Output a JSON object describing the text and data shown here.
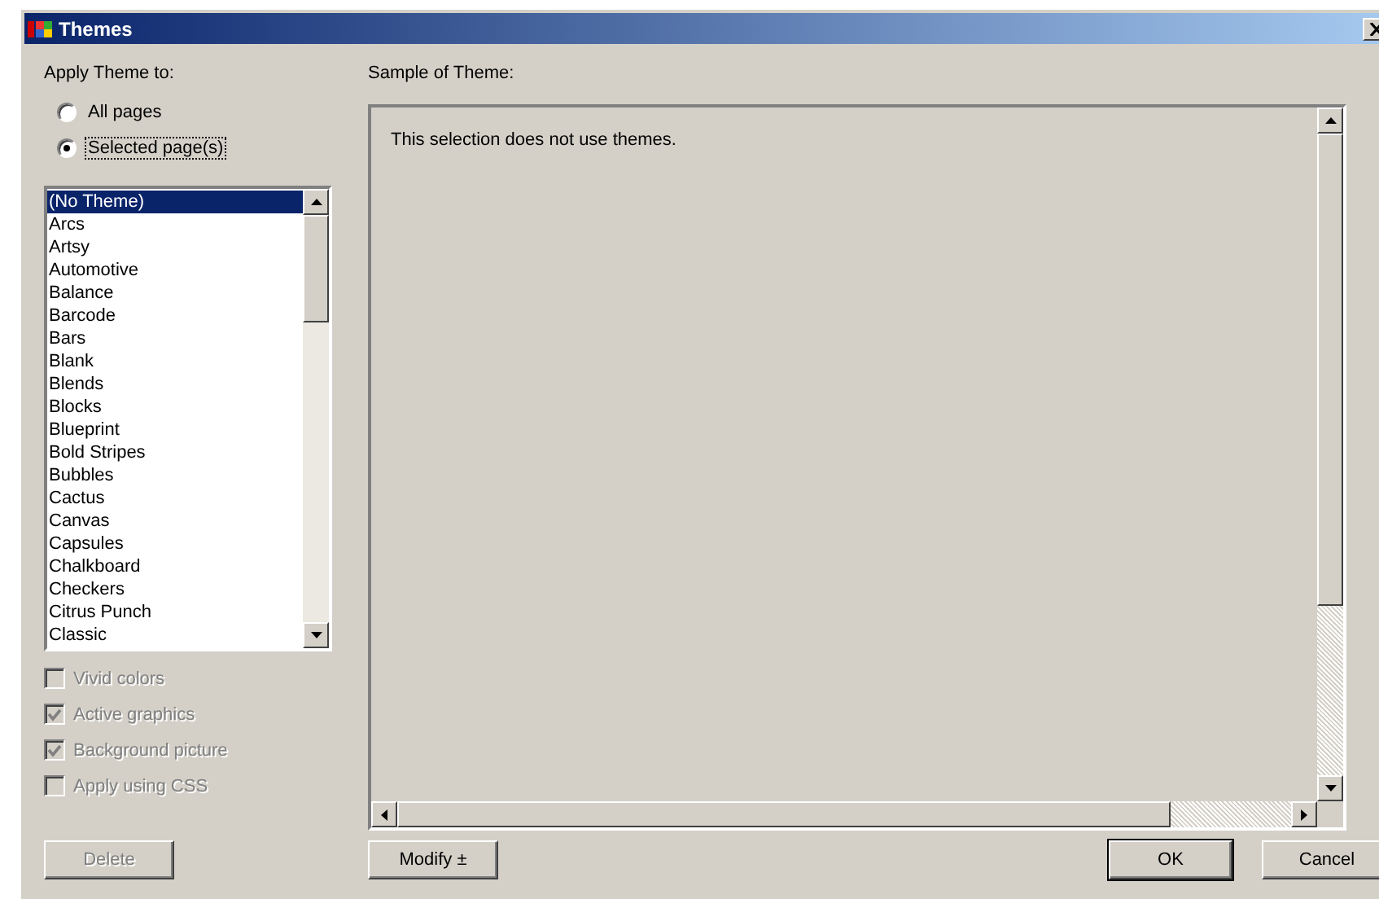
{
  "window": {
    "title": "Themes"
  },
  "apply": {
    "label": "Apply Theme to:",
    "options": [
      {
        "label": "All pages",
        "selected": false
      },
      {
        "label": "Selected page(s)",
        "selected": true
      }
    ]
  },
  "themes": [
    {
      "label": "(No Theme)",
      "selected": true
    },
    {
      "label": "Arcs",
      "selected": false
    },
    {
      "label": "Artsy",
      "selected": false
    },
    {
      "label": "Automotive",
      "selected": false
    },
    {
      "label": "Balance",
      "selected": false
    },
    {
      "label": "Barcode",
      "selected": false
    },
    {
      "label": "Bars",
      "selected": false
    },
    {
      "label": "Blank",
      "selected": false
    },
    {
      "label": "Blends",
      "selected": false
    },
    {
      "label": "Blocks",
      "selected": false
    },
    {
      "label": "Blueprint",
      "selected": false
    },
    {
      "label": "Bold Stripes",
      "selected": false
    },
    {
      "label": "Bubbles",
      "selected": false
    },
    {
      "label": "Cactus",
      "selected": false
    },
    {
      "label": "Canvas",
      "selected": false
    },
    {
      "label": "Capsules",
      "selected": false
    },
    {
      "label": "Chalkboard",
      "selected": false
    },
    {
      "label": "Checkers",
      "selected": false
    },
    {
      "label": "Citrus Punch",
      "selected": false
    },
    {
      "label": "Classic",
      "selected": false
    }
  ],
  "options": [
    {
      "label": "Vivid colors",
      "checked": false,
      "disabled": true
    },
    {
      "label": "Active graphics",
      "checked": true,
      "disabled": true
    },
    {
      "label": "Background picture",
      "checked": true,
      "disabled": true
    },
    {
      "label": "Apply using CSS",
      "checked": false,
      "disabled": true
    }
  ],
  "sample": {
    "label": "Sample of Theme:",
    "message": "This selection does not use themes."
  },
  "buttons": {
    "delete": {
      "label": "Delete",
      "disabled": true
    },
    "modify": {
      "label": "Modify ±"
    },
    "ok": {
      "label": "OK"
    },
    "cancel": {
      "label": "Cancel"
    }
  }
}
